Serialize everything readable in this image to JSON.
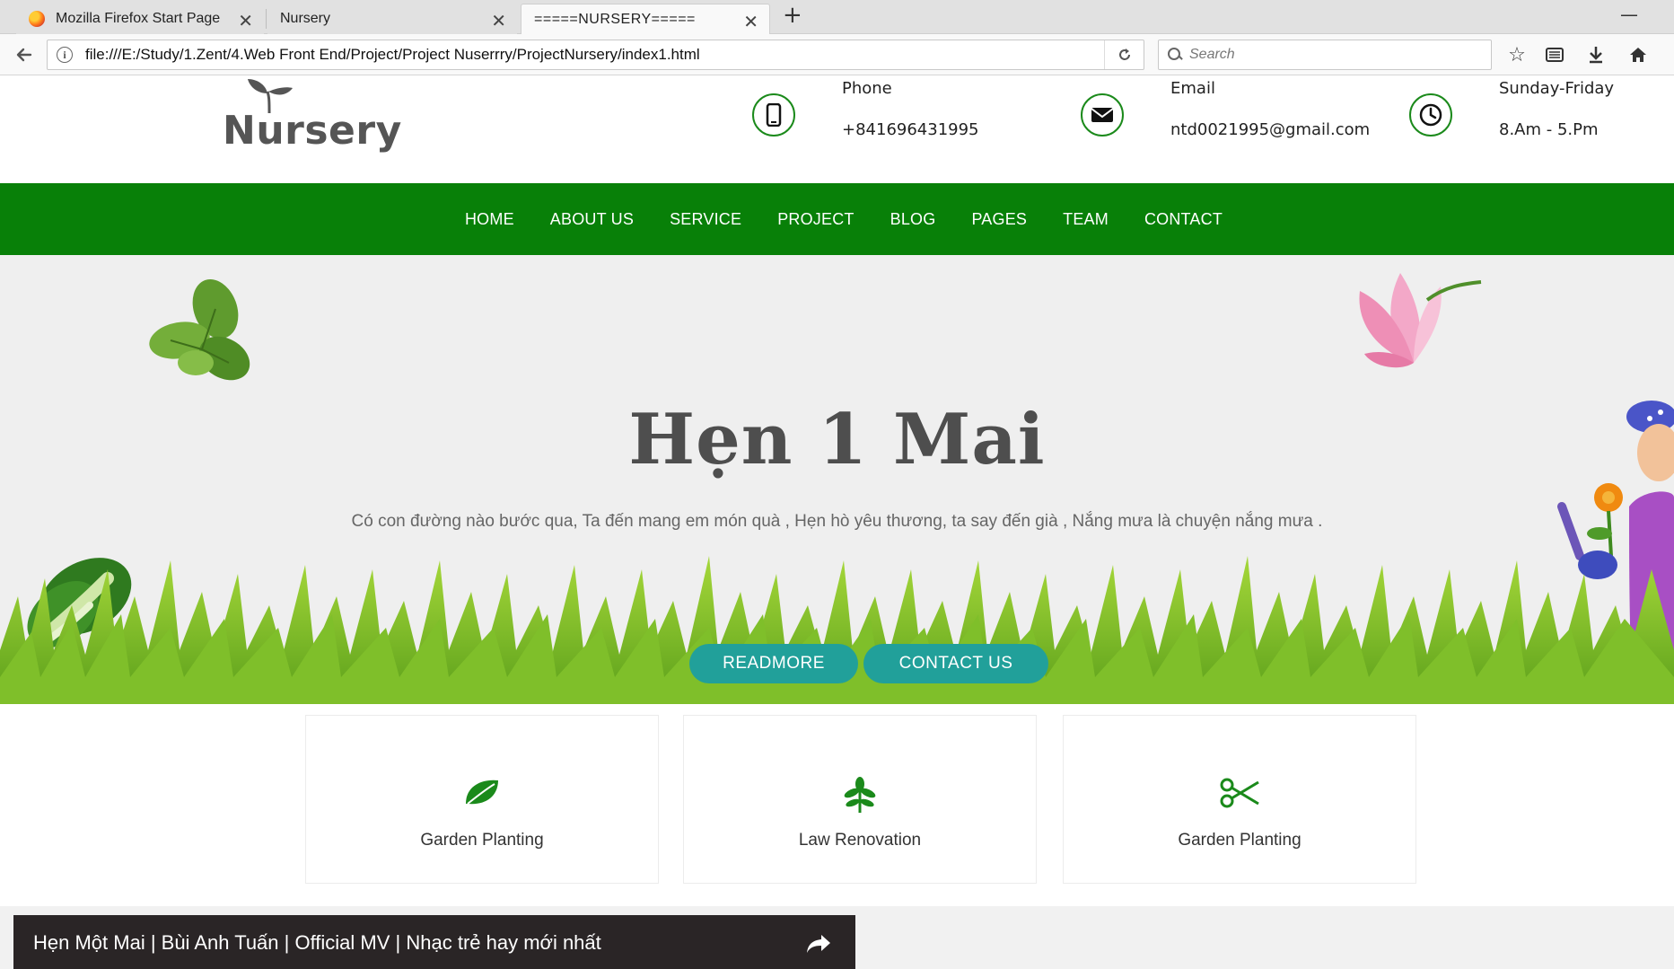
{
  "browser": {
    "tabs": [
      {
        "title": "Mozilla Firefox Start Page",
        "active": false
      },
      {
        "title": "Nursery",
        "active": false
      },
      {
        "title": "=====NURSERY=====",
        "active": true
      }
    ],
    "url": "file:///E:/Study/1.Zent/4.Web Front End/Project/Project Nuserrry/ProjectNursery/index1.html",
    "search_placeholder": "Search",
    "icons": [
      "back-arrow-icon",
      "info-icon",
      "reload-icon",
      "search-icon",
      "star-icon",
      "reading-list-icon",
      "download-icon",
      "home-icon"
    ]
  },
  "site": {
    "logo_text": "Nursery",
    "contacts": [
      {
        "label": "Phone",
        "value": "+841696431995",
        "icon": "phone-icon"
      },
      {
        "label": "Email",
        "value": "ntd0021995@gmail.com",
        "icon": "envelope-icon"
      },
      {
        "label": "Sunday-Friday",
        "value": "8.Am - 5.Pm",
        "icon": "clock-icon"
      }
    ],
    "menu": [
      "HOME",
      "ABOUT US",
      "SERVICE",
      "PROJECT",
      "BLOG",
      "PAGES",
      "TEAM",
      "CONTACT"
    ],
    "hero": {
      "title": "Hẹn 1 Mai",
      "subtitle": "Có con đường nào bước qua, Ta đến mang em món quà , Hẹn hò yêu thương, ta say đến già , Nắng mưa là chuyện nắng mưa .",
      "buttons": [
        "READMORE",
        "CONTACT US"
      ]
    },
    "features": [
      {
        "label": "Garden Planting",
        "icon": "leaf-icon"
      },
      {
        "label": "Law Renovation",
        "icon": "sprout-icon"
      },
      {
        "label": "Garden Planting",
        "icon": "scissors-icon"
      }
    ],
    "video_title": "Hẹn Một Mai | Bùi Anh Tuấn | Official MV | Nhạc trẻ hay mới nhất"
  },
  "colors": {
    "menu_bg": "#088008",
    "accent_green": "#1b8a1b",
    "button_teal": "#21a09a",
    "hero_bg": "#efefef"
  }
}
